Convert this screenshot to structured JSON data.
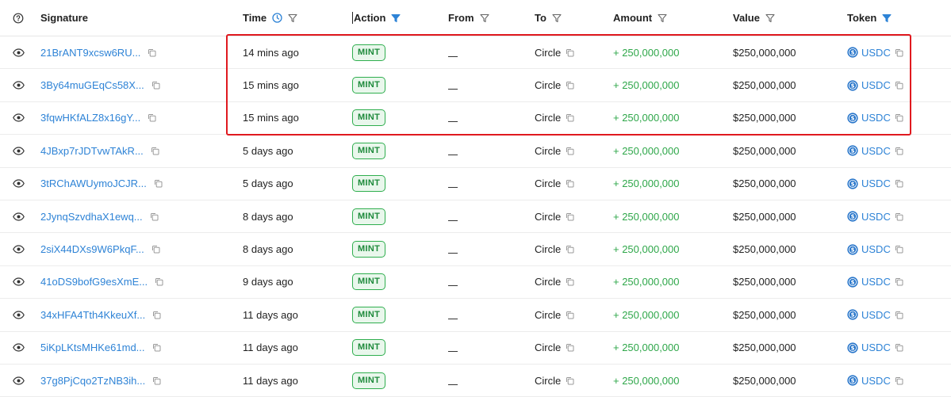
{
  "header": {
    "info_icon": "help-circle-icon",
    "signature": "Signature",
    "time": "Time",
    "action": "Action",
    "from": "From",
    "to": "To",
    "amount": "Amount",
    "value": "Value",
    "token": "Token"
  },
  "colors": {
    "link": "#2e83d6",
    "positive": "#2fa74a",
    "badge_border": "#2fae4e",
    "badge_bg": "#e9f7ec",
    "highlight": "#e0191f",
    "active_filter": "#2e83d6"
  },
  "rows": [
    {
      "signature": "21BrANT9xcsw6RU...",
      "time": "14 mins ago",
      "action": "MINT",
      "from": "",
      "to": "Circle",
      "amount": "+ 250,000,000",
      "value": "$250,000,000",
      "token": "USDC"
    },
    {
      "signature": "3By64muGEqCs58X...",
      "time": "15 mins ago",
      "action": "MINT",
      "from": "",
      "to": "Circle",
      "amount": "+ 250,000,000",
      "value": "$250,000,000",
      "token": "USDC"
    },
    {
      "signature": "3fqwHKfALZ8x16gY...",
      "time": "15 mins ago",
      "action": "MINT",
      "from": "",
      "to": "Circle",
      "amount": "+ 250,000,000",
      "value": "$250,000,000",
      "token": "USDC"
    },
    {
      "signature": "4JBxp7rJDTvwTAkR...",
      "time": "5 days ago",
      "action": "MINT",
      "from": "",
      "to": "Circle",
      "amount": "+ 250,000,000",
      "value": "$250,000,000",
      "token": "USDC"
    },
    {
      "signature": "3tRChAWUymoJCJR...",
      "time": "5 days ago",
      "action": "MINT",
      "from": "",
      "to": "Circle",
      "amount": "+ 250,000,000",
      "value": "$250,000,000",
      "token": "USDC"
    },
    {
      "signature": "2JynqSzvdhaX1ewq...",
      "time": "8 days ago",
      "action": "MINT",
      "from": "",
      "to": "Circle",
      "amount": "+ 250,000,000",
      "value": "$250,000,000",
      "token": "USDC"
    },
    {
      "signature": "2siX44DXs9W6PkqF...",
      "time": "8 days ago",
      "action": "MINT",
      "from": "",
      "to": "Circle",
      "amount": "+ 250,000,000",
      "value": "$250,000,000",
      "token": "USDC"
    },
    {
      "signature": "41oDS9bofG9esXmE...",
      "time": "9 days ago",
      "action": "MINT",
      "from": "",
      "to": "Circle",
      "amount": "+ 250,000,000",
      "value": "$250,000,000",
      "token": "USDC"
    },
    {
      "signature": "34xHFA4Tth4KkeuXf...",
      "time": "11 days ago",
      "action": "MINT",
      "from": "",
      "to": "Circle",
      "amount": "+ 250,000,000",
      "value": "$250,000,000",
      "token": "USDC"
    },
    {
      "signature": "5iKpLKtsMHKe61md...",
      "time": "11 days ago",
      "action": "MINT",
      "from": "",
      "to": "Circle",
      "amount": "+ 250,000,000",
      "value": "$250,000,000",
      "token": "USDC"
    },
    {
      "signature": "37g8PjCqo2TzNB3ih...",
      "time": "11 days ago",
      "action": "MINT",
      "from": "",
      "to": "Circle",
      "amount": "+ 250,000,000",
      "value": "$250,000,000",
      "token": "USDC"
    }
  ]
}
